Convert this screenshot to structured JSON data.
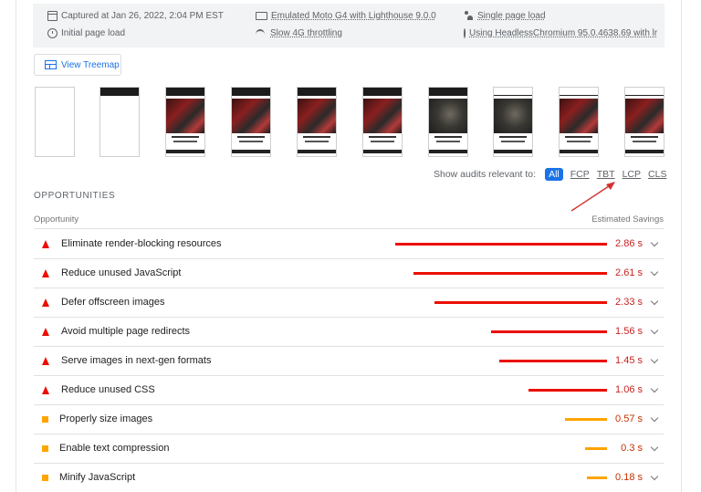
{
  "environment": {
    "captured": "Captured at Jan 26, 2022, 2:04 PM EST",
    "load_type": "Initial page load",
    "device": "Emulated Moto G4 with Lighthouse 9.0.0",
    "throttling": "Slow 4G throttling",
    "session": "Single page load",
    "browser": "Using HeadlessChromium 95.0.4638.69 with lr"
  },
  "treemap_label": "View Treemap",
  "filter": {
    "label": "Show audits relevant to:",
    "options": [
      "All",
      "FCP",
      "TBT",
      "LCP",
      "CLS"
    ],
    "active": "All"
  },
  "section": {
    "title": "OPPORTUNITIES",
    "col_left": "Opportunity",
    "col_right": "Estimated Savings"
  },
  "colors": {
    "fail": "#eb0f00",
    "average": "#ffa400",
    "accent": "#1a73e8"
  },
  "audits": [
    {
      "title": "Eliminate render-blocking resources",
      "savings": "2.86 s",
      "seconds": 2.86,
      "rating": "fail"
    },
    {
      "title": "Reduce unused JavaScript",
      "savings": "2.61 s",
      "seconds": 2.61,
      "rating": "fail"
    },
    {
      "title": "Defer offscreen images",
      "savings": "2.33 s",
      "seconds": 2.33,
      "rating": "fail"
    },
    {
      "title": "Avoid multiple page redirects",
      "savings": "1.56 s",
      "seconds": 1.56,
      "rating": "fail"
    },
    {
      "title": "Serve images in next-gen formats",
      "savings": "1.45 s",
      "seconds": 1.45,
      "rating": "fail"
    },
    {
      "title": "Reduce unused CSS",
      "savings": "1.06 s",
      "seconds": 1.06,
      "rating": "fail"
    },
    {
      "title": "Properly size images",
      "savings": "0.57 s",
      "seconds": 0.57,
      "rating": "average"
    },
    {
      "title": "Enable text compression",
      "savings": "0.3 s",
      "seconds": 0.3,
      "rating": "average"
    },
    {
      "title": "Minify JavaScript",
      "savings": "0.18 s",
      "seconds": 0.18,
      "rating": "average"
    }
  ]
}
